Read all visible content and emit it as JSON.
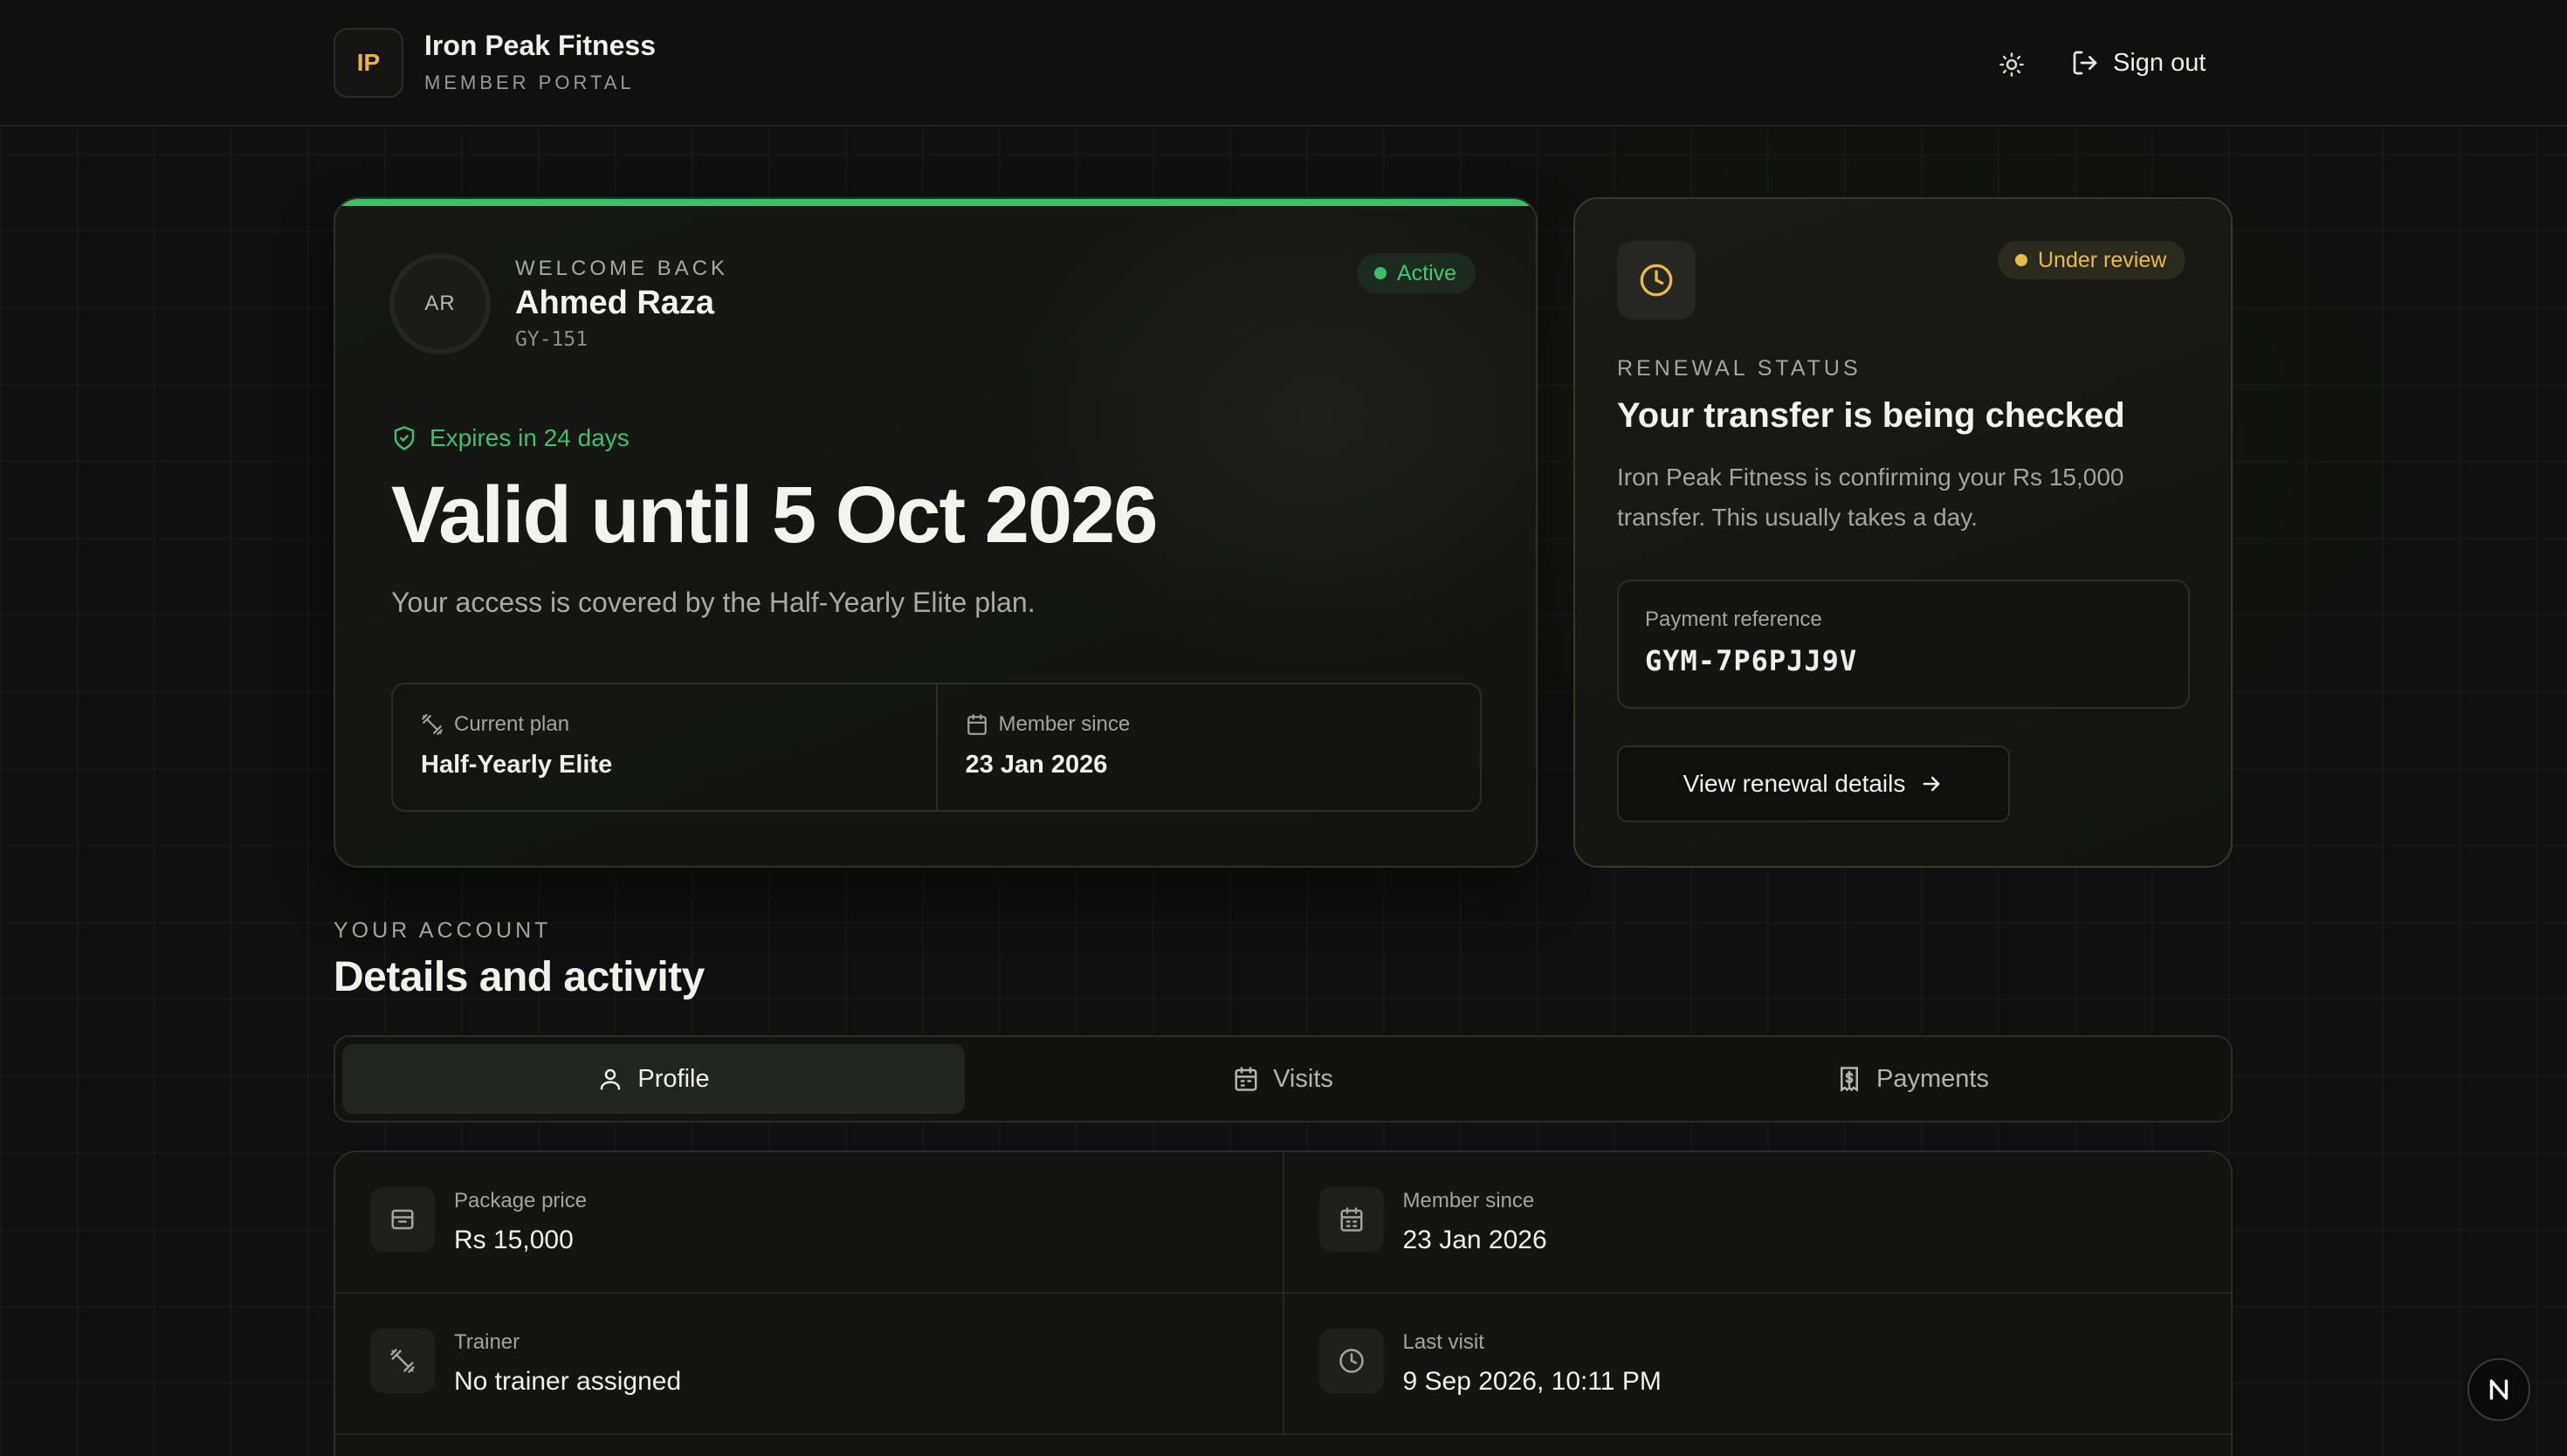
{
  "header": {
    "logo_initials": "IP",
    "brand_name": "Iron Peak Fitness",
    "brand_subtitle": "MEMBER PORTAL",
    "sign_out_label": "Sign out"
  },
  "membership": {
    "avatar_initials": "AR",
    "welcome_label": "WELCOME BACK",
    "name": "Ahmed Raza",
    "member_id": "GY-151",
    "status": "Active",
    "expires_text": "Expires in 24 days",
    "valid_until": "Valid until 5 Oct 2026",
    "coverage_text": "Your access is covered by the Half-Yearly Elite plan.",
    "current_plan_label": "Current plan",
    "current_plan_value": "Half-Yearly Elite",
    "member_since_label": "Member since",
    "member_since_value": "23 Jan 2026"
  },
  "renewal": {
    "status_badge": "Under review",
    "eyebrow": "RENEWAL STATUS",
    "title": "Your transfer is being checked",
    "description": "Iron Peak Fitness is confirming your Rs 15,000 transfer. This usually takes a day.",
    "reference_label": "Payment reference",
    "reference_value": "GYM-7P6PJJ9V",
    "button_label": "View renewal details"
  },
  "account": {
    "eyebrow": "YOUR ACCOUNT",
    "title": "Details and activity",
    "tabs": [
      {
        "label": "Profile",
        "icon": "user-icon",
        "active": true
      },
      {
        "label": "Visits",
        "icon": "calendar-icon",
        "active": false
      },
      {
        "label": "Payments",
        "icon": "receipt-icon",
        "active": false
      }
    ],
    "details": [
      {
        "label": "Package price",
        "value": "Rs 15,000",
        "icon": "package-icon"
      },
      {
        "label": "Member since",
        "value": "23 Jan 2026",
        "icon": "calendar-icon"
      },
      {
        "label": "Trainer",
        "value": "No trainer assigned",
        "icon": "dumbbell-icon"
      },
      {
        "label": "Last visit",
        "value": "9 Sep 2026, 10:11 PM",
        "icon": "clock-icon"
      }
    ]
  },
  "colors": {
    "accent_green": "#35c26a",
    "accent_amber": "#e6bd42",
    "background": "#0e0f0e"
  },
  "dev_badge": "N"
}
